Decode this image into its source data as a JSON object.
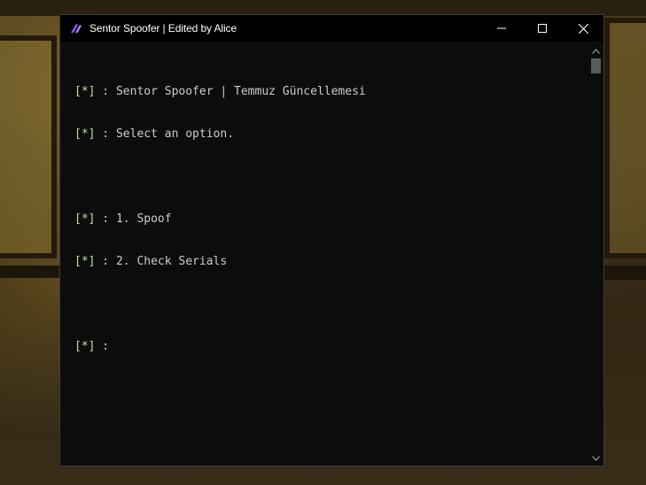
{
  "window": {
    "title": "Sentor Spoofer | Edited by Alice",
    "icon": "app-icon",
    "controls": [
      "minimize-icon",
      "maximize-icon",
      "close-icon"
    ]
  },
  "console": {
    "prompt_marker": "[*]",
    "lines": [
      {
        "marker": "[*]",
        "text": " : Sentor Spoofer | Temmuz Güncellemesi"
      },
      {
        "marker": "[*]",
        "text": " : Select an option."
      },
      {
        "marker": "",
        "text": ""
      },
      {
        "marker": "[*]",
        "text": " : 1. Spoof"
      },
      {
        "marker": "[*]",
        "text": " : 2. Check Serials"
      },
      {
        "marker": "",
        "text": ""
      },
      {
        "marker": "[*]",
        "text": " : "
      }
    ]
  },
  "colors": {
    "console_bg": "#0c0c0c",
    "console_text": "#cccccc",
    "prompt_marker": "#b9e0a5",
    "titlebar_bg": "#000000",
    "app_icon": "#8a5cf6"
  }
}
